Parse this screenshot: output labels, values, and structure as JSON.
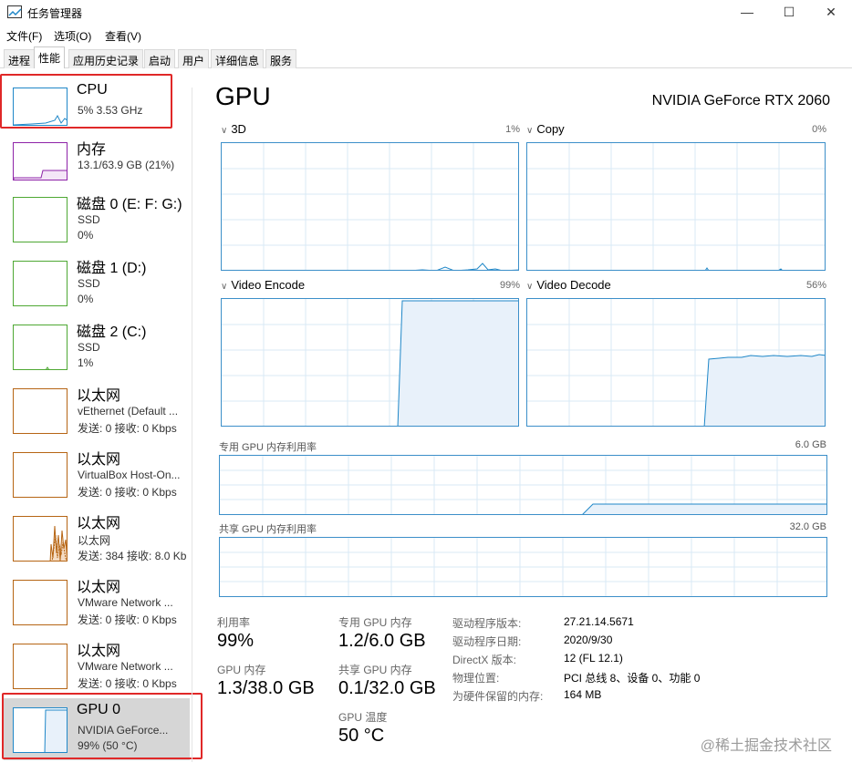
{
  "window": {
    "title": "任务管理器",
    "minimize": "—",
    "maximize": "☐",
    "close": "✕"
  },
  "menu": [
    "文件(F)",
    "选项(O)",
    "查看(V)"
  ],
  "tabs": [
    "进程",
    "性能",
    "应用历史记录",
    "启动",
    "用户",
    "详细信息",
    "服务"
  ],
  "active_tab": "性能",
  "sidebar": [
    {
      "title": "CPU",
      "line1": "5% 3.53 GHz",
      "line2": "",
      "color": "#1f87c8"
    },
    {
      "title": "内存",
      "line1": "13.1/63.9 GB (21%)",
      "line2": "",
      "color": "#8e23a8"
    },
    {
      "title": "磁盘 0 (E: F: G:)",
      "line1": "SSD",
      "line2": "0%",
      "color": "#4ea833"
    },
    {
      "title": "磁盘 1 (D:)",
      "line1": "SSD",
      "line2": "0%",
      "color": "#4ea833"
    },
    {
      "title": "磁盘 2 (C:)",
      "line1": "SSD",
      "line2": "1%",
      "color": "#4ea833"
    },
    {
      "title": "以太网",
      "line1": "vEthernet (Default ...",
      "line2": "发送: 0 接收: 0 Kbps",
      "color": "#b66514"
    },
    {
      "title": "以太网",
      "line1": "VirtualBox Host-On...",
      "line2": "发送: 0 接收: 0 Kbps",
      "color": "#b66514"
    },
    {
      "title": "以太网",
      "line1": "以太网",
      "line2": "发送: 384 接收: 8.0 Kb",
      "color": "#b66514"
    },
    {
      "title": "以太网",
      "line1": "VMware Network ...",
      "line2": "发送: 0 接收: 0 Kbps",
      "color": "#b66514"
    },
    {
      "title": "以太网",
      "line1": "VMware Network ...",
      "line2": "发送: 0 接收: 0 Kbps",
      "color": "#b66514"
    },
    {
      "title": "GPU 0",
      "line1": "NVIDIA GeForce...",
      "line2": "99% (50 °C)",
      "color": "#1f87c8"
    }
  ],
  "main": {
    "title": "GPU",
    "model": "NVIDIA GeForce RTX 2060",
    "engines": [
      {
        "name": "3D",
        "pct": "1%"
      },
      {
        "name": "Copy",
        "pct": "0%"
      },
      {
        "name": "Video Encode",
        "pct": "99%"
      },
      {
        "name": "Video Decode",
        "pct": "56%"
      }
    ],
    "dedicated_label": "专用 GPU 内存利用率",
    "dedicated_max": "6.0 GB",
    "shared_label": "共享 GPU 内存利用率",
    "shared_max": "32.0 GB"
  },
  "stats": {
    "utilization_label": "利用率",
    "utilization": "99%",
    "gpu_mem_label": "GPU 内存",
    "gpu_mem": "1.3/38.0 GB",
    "dedicated_label": "专用 GPU 内存",
    "dedicated": "1.2/6.0 GB",
    "shared_label": "共享 GPU 内存",
    "shared": "0.1/32.0 GB",
    "temp_label": "GPU 温度",
    "temp": "50 °C"
  },
  "info": [
    {
      "label": "驱动程序版本:",
      "value": "27.21.14.5671"
    },
    {
      "label": "驱动程序日期:",
      "value": "2020/9/30"
    },
    {
      "label": "DirectX 版本:",
      "value": "12 (FL 12.1)"
    },
    {
      "label": "物理位置:",
      "value": "PCI 总线 8、设备 0、功能 0"
    },
    {
      "label": "为硬件保留的内存:",
      "value": "164 MB"
    }
  ],
  "watermark": "@稀土掘金技术社区",
  "colors": {
    "accent": "#1f87c8",
    "highlight": "#e02828",
    "graph_border": "#3c8fc9"
  }
}
